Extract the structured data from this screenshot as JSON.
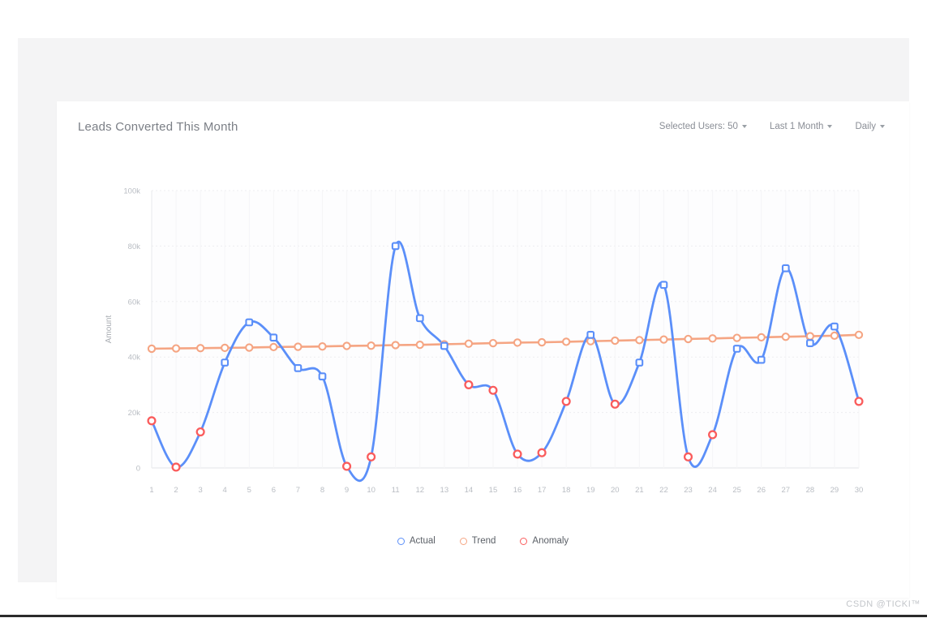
{
  "card": {
    "title": "Leads Converted This Month",
    "controls": [
      {
        "name": "selected-users-dropdown",
        "label": "Selected Users: 50"
      },
      {
        "name": "date-range-dropdown",
        "label": "Last 1 Month"
      },
      {
        "name": "granularity-dropdown",
        "label": "Daily"
      }
    ]
  },
  "watermark": "CSDN @TICKI™",
  "colors": {
    "actual": "#5b8ff9",
    "trend": "#f5a583",
    "anomaly": "#fa5c5c",
    "grid": "#ededf0",
    "axis_text": "#b9bdc3",
    "title_text": "#7b7f86"
  },
  "chart_data": {
    "type": "line",
    "title": "Leads Converted This Month",
    "xlabel": "",
    "ylabel": "Amount",
    "ylim": [
      0,
      100000
    ],
    "yticks": [
      0,
      20000,
      40000,
      60000,
      80000,
      100000
    ],
    "ytick_labels": [
      "0",
      "20k",
      "40k",
      "60k",
      "80k",
      "100k"
    ],
    "grid": true,
    "legend_position": "bottom-center",
    "x": [
      1,
      2,
      3,
      4,
      5,
      6,
      7,
      8,
      9,
      10,
      11,
      12,
      13,
      14,
      15,
      16,
      17,
      18,
      19,
      20,
      21,
      22,
      23,
      24,
      25,
      26,
      27,
      28,
      29,
      30
    ],
    "xtick_labels": [
      "1",
      "2",
      "3",
      "4",
      "5",
      "6",
      "7",
      "8",
      "9",
      "10",
      "11",
      "12",
      "13",
      "14",
      "15",
      "16",
      "17",
      "18",
      "19",
      "20",
      "21",
      "22",
      "23",
      "24",
      "25",
      "26",
      "27",
      "28",
      "29",
      "30"
    ],
    "series": [
      {
        "name": "Actual",
        "color": "#5b8ff9",
        "marker": "open-circle",
        "values": [
          17000,
          300,
          13000,
          38000,
          52500,
          47000,
          36000,
          33000,
          600,
          4000,
          80000,
          54000,
          44000,
          30000,
          28000,
          5000,
          5500,
          24000,
          48000,
          23000,
          38000,
          66000,
          4000,
          12000,
          43000,
          39000,
          72000,
          45000,
          51000,
          24000
        ]
      },
      {
        "name": "Trend",
        "color": "#f5a583",
        "marker": "open-circle",
        "values": [
          43000,
          43100,
          43200,
          43300,
          43400,
          43600,
          43700,
          43800,
          44000,
          44100,
          44300,
          44400,
          44600,
          44800,
          45000,
          45200,
          45300,
          45500,
          45700,
          45900,
          46100,
          46300,
          46500,
          46700,
          46900,
          47100,
          47300,
          47500,
          47700,
          48000
        ]
      }
    ],
    "anomaly": {
      "name": "Anomaly",
      "color": "#fa5c5c",
      "marker": "open-circle",
      "points": [
        {
          "x": 1,
          "y": 17000
        },
        {
          "x": 2,
          "y": 300
        },
        {
          "x": 3,
          "y": 13000
        },
        {
          "x": 9,
          "y": 600
        },
        {
          "x": 10,
          "y": 4000
        },
        {
          "x": 14,
          "y": 30000
        },
        {
          "x": 15,
          "y": 28000
        },
        {
          "x": 16,
          "y": 5000
        },
        {
          "x": 17,
          "y": 5500
        },
        {
          "x": 18,
          "y": 24000
        },
        {
          "x": 20,
          "y": 23000
        },
        {
          "x": 23,
          "y": 4000
        },
        {
          "x": 24,
          "y": 12000
        },
        {
          "x": 30,
          "y": 24000
        }
      ]
    },
    "legend": [
      {
        "label": "Actual",
        "color": "#5b8ff9"
      },
      {
        "label": "Trend",
        "color": "#f5a583"
      },
      {
        "label": "Anomaly",
        "color": "#fa5c5c"
      }
    ]
  }
}
